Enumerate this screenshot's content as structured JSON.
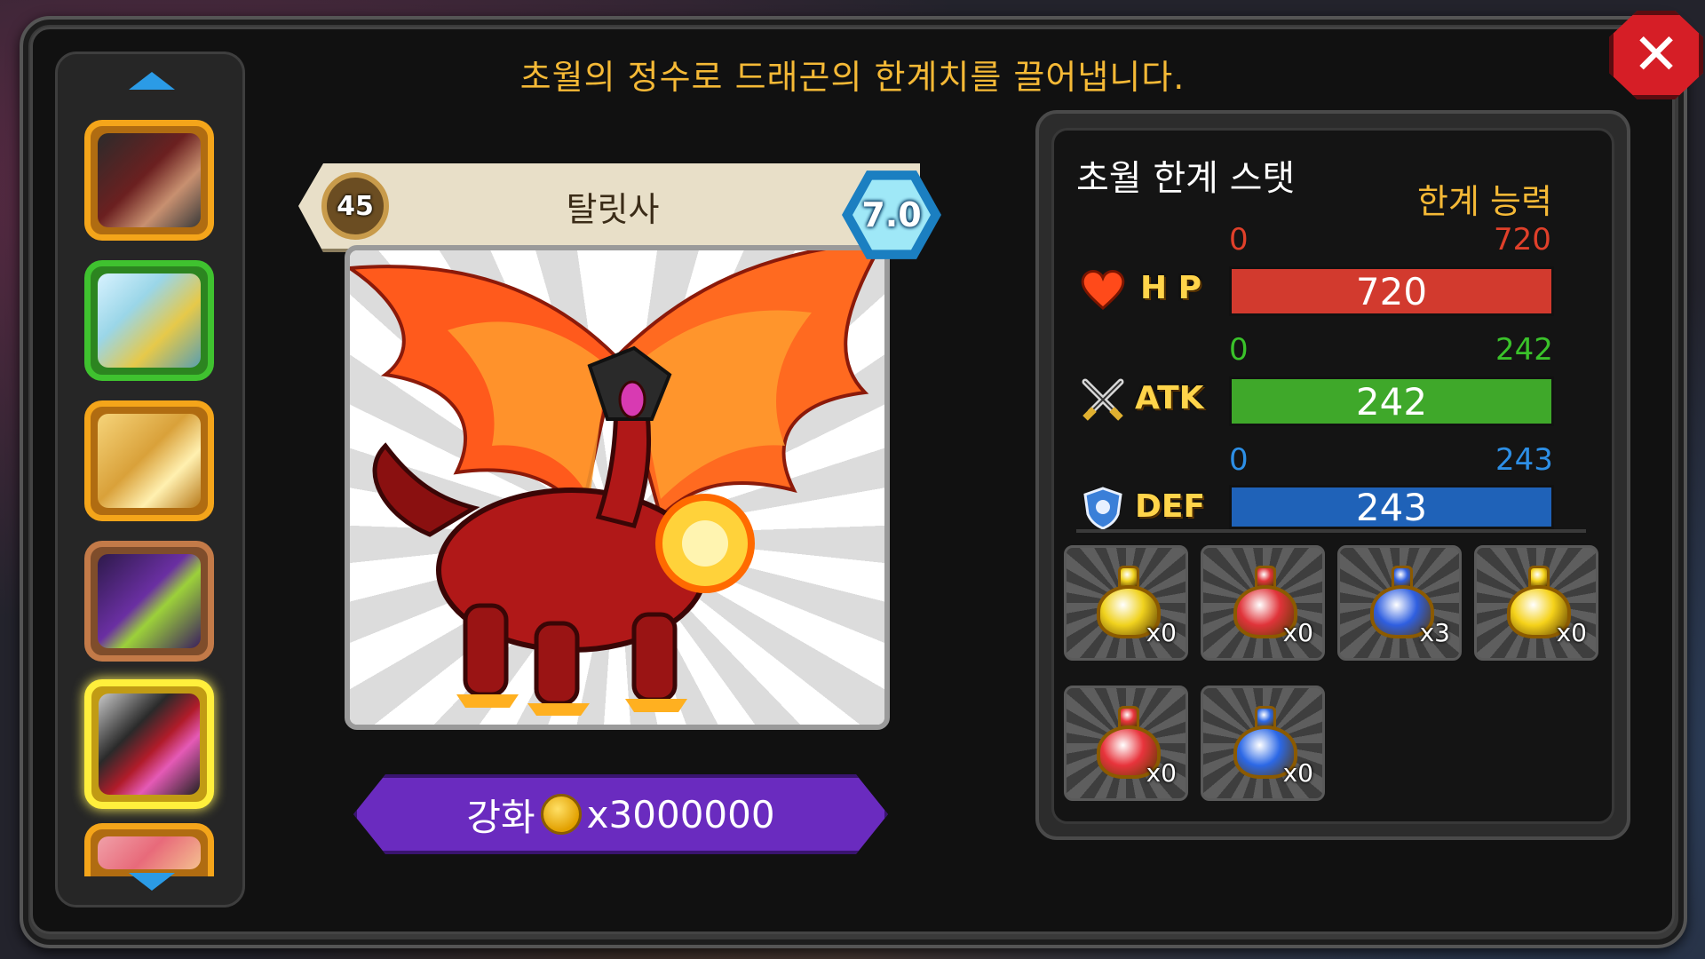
{
  "header": {
    "message": "초월의 정수로 드래곤의 한계치를 끌어냅니다."
  },
  "close": {
    "label": "✕"
  },
  "dragon": {
    "level": "45",
    "name": "탈릿사",
    "grade": "7.0"
  },
  "enhance": {
    "label": "강화",
    "cost": "x3000000"
  },
  "stats_panel": {
    "title": "초월 한계 스탯",
    "limit_label": "한계 능력",
    "stats": [
      {
        "key": "hp",
        "label": "H P",
        "min": "0",
        "max": "720",
        "value": "720",
        "fraction": 1.0,
        "color": "#d23a2e",
        "range_color": "#e0402a",
        "icon": "heart-icon"
      },
      {
        "key": "atk",
        "label": "ATK",
        "min": "0",
        "max": "242",
        "value": "242",
        "fraction": 1.0,
        "color": "#3fa82a",
        "range_color": "#3ac22a",
        "icon": "crossed-swords-icon"
      },
      {
        "key": "def",
        "label": "DEF",
        "min": "0",
        "max": "243",
        "value": "243",
        "fraction": 1.0,
        "color": "#1f62b8",
        "range_color": "#2d8fe6",
        "icon": "shield-icon"
      }
    ]
  },
  "items": [
    {
      "icon": "yellow-potion-icon",
      "color": "#f0d21e",
      "count": "x0"
    },
    {
      "icon": "red-potion-icon",
      "color": "#e0343a",
      "count": "x0"
    },
    {
      "icon": "blue-potion-icon",
      "color": "#2f5fe0",
      "count": "x3"
    },
    {
      "icon": "large-yellow-potion-icon",
      "color": "#f5d21a",
      "count": "x0"
    },
    {
      "icon": "large-red-potion-icon",
      "color": "#e8343c",
      "count": "x0"
    },
    {
      "icon": "large-blue-potion-icon",
      "color": "#2c68e6",
      "count": "x0"
    }
  ],
  "dragon_list": [
    {
      "name": "black-dragon-portrait",
      "frame": "gold"
    },
    {
      "name": "ice-dragon-portrait",
      "frame": "green"
    },
    {
      "name": "golden-dragon-portrait",
      "frame": "gold"
    },
    {
      "name": "purple-dragon-portrait",
      "frame": "bronze"
    },
    {
      "name": "fire-dragon-portrait",
      "frame": "selected"
    },
    {
      "name": "pink-dragon-portrait",
      "frame": "gold"
    }
  ]
}
